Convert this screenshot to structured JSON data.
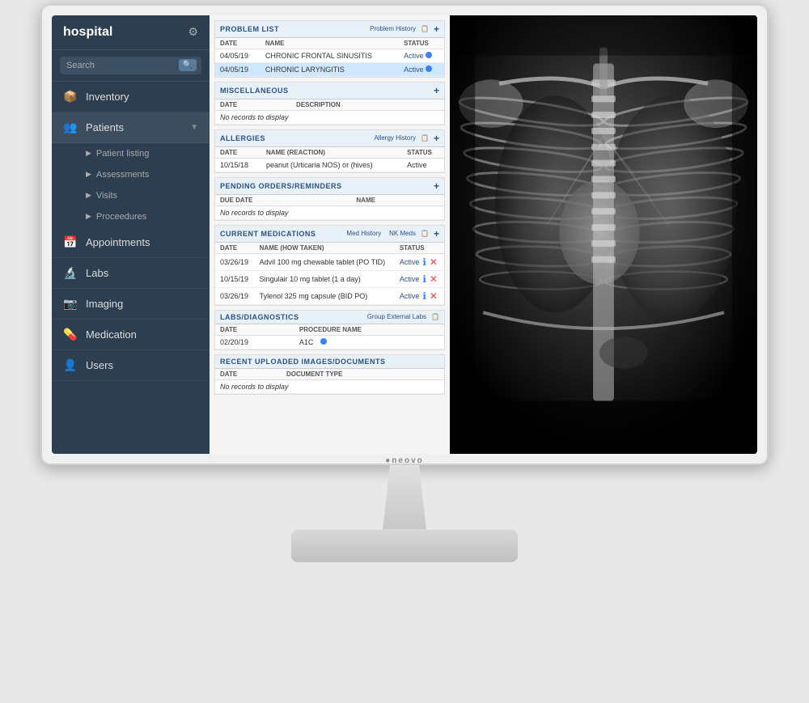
{
  "app": {
    "name": "hospital",
    "brand": "●neovo"
  },
  "sidebar": {
    "search_placeholder": "Search",
    "items": [
      {
        "id": "inventory",
        "label": "Inventory",
        "icon": "📦",
        "hasArrow": false
      },
      {
        "id": "patients",
        "label": "Patients",
        "icon": "👥",
        "hasArrow": true,
        "expanded": true
      },
      {
        "id": "patient-listing",
        "label": "Patient listing",
        "sub": true
      },
      {
        "id": "assessments",
        "label": "Assessments",
        "sub": true
      },
      {
        "id": "visits",
        "label": "Visits",
        "sub": true
      },
      {
        "id": "procedures",
        "label": "Proceedures",
        "sub": true
      },
      {
        "id": "appointments",
        "label": "Appointments",
        "icon": "📅",
        "hasArrow": false
      },
      {
        "id": "labs",
        "label": "Labs",
        "icon": "🔬",
        "hasArrow": false
      },
      {
        "id": "imaging",
        "label": "Imaging",
        "icon": "📷",
        "hasArrow": false
      },
      {
        "id": "medication",
        "label": "Medication",
        "icon": "💊",
        "hasArrow": false
      },
      {
        "id": "users",
        "label": "Users",
        "icon": "👤",
        "hasArrow": false
      }
    ]
  },
  "problem_list": {
    "title": "Problem List",
    "history_label": "Problem History",
    "columns": [
      "Date",
      "Name",
      "Status"
    ],
    "rows": [
      {
        "date": "04/05/19",
        "name": "CHRONIC FRONTAL SINUSITIS",
        "status": "Active",
        "selected": false
      },
      {
        "date": "04/05/19",
        "name": "CHRONIC LARYNGITIS",
        "status": "Active",
        "selected": true
      }
    ]
  },
  "miscellaneous": {
    "title": "Miscellaneous",
    "columns": [
      "Date",
      "Description"
    ],
    "empty": "No records to display"
  },
  "allergies": {
    "title": "Allergies",
    "history_label": "Allergy History",
    "columns": [
      "Date",
      "Name (Reaction)",
      "Status"
    ],
    "rows": [
      {
        "date": "10/15/18",
        "name": "peanut (Urticaria NOS) or (hives)",
        "status": "Active"
      }
    ]
  },
  "pending_orders": {
    "title": "Pending Orders/Reminders",
    "columns": [
      "Due Date",
      "Name"
    ],
    "empty": "No records to display"
  },
  "current_medications": {
    "title": "Current Medications",
    "history_label": "Med History",
    "nk_label": "NK Meds",
    "columns": [
      "Date",
      "Name (How Taken)",
      "Status"
    ],
    "rows": [
      {
        "date": "03/26/19",
        "name": "Advil 100 mg chewable tablet (PO TID)",
        "status": "Active"
      },
      {
        "date": "10/15/19",
        "name": "Singulair 10 mg tablet (1 a day)",
        "status": "Active"
      },
      {
        "date": "03/26/19",
        "name": "Tylenol 325 mg capsule (BID PO)",
        "status": "Active"
      }
    ]
  },
  "labs_diagnostics": {
    "title": "Labs/Diagnostics",
    "group_label": "Group External Labs",
    "columns": [
      "Date",
      "Procedure Name"
    ],
    "rows": [
      {
        "date": "02/20/19",
        "name": "A1C"
      }
    ]
  },
  "recent_uploads": {
    "title": "Recent Uploaded Images/Documents",
    "columns": [
      "Date",
      "Document Type"
    ],
    "empty": "No records to display"
  }
}
